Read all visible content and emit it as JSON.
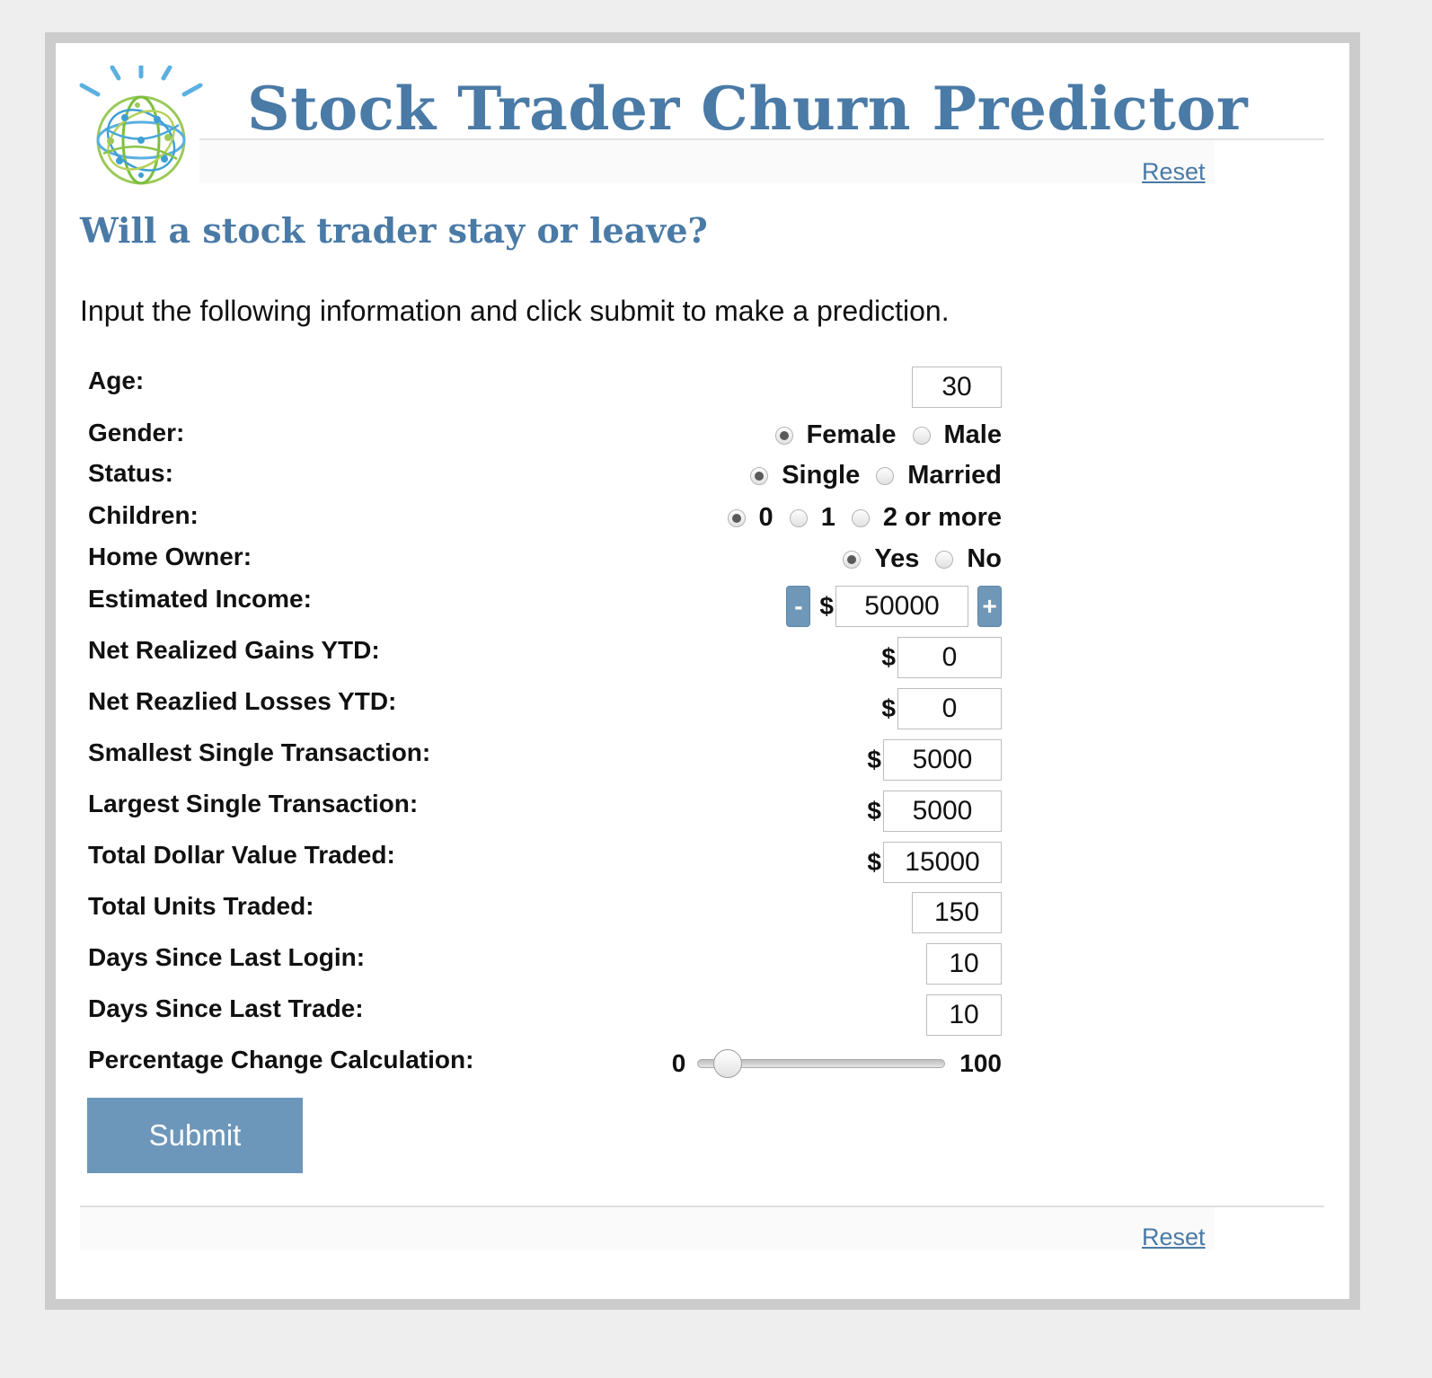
{
  "header": {
    "title": "Stock Trader Churn Predictor",
    "reset_label": "Reset"
  },
  "intro": {
    "heading": "Will a stock trader stay or leave?",
    "text": "Input the following information and click submit to make a prediction."
  },
  "form": {
    "currency_symbol": "$",
    "age": {
      "label": "Age:",
      "value": "30"
    },
    "gender": {
      "label": "Gender:",
      "options": [
        "Female",
        "Male"
      ],
      "selected": "Female"
    },
    "status": {
      "label": "Status:",
      "options": [
        "Single",
        "Married"
      ],
      "selected": "Single"
    },
    "children": {
      "label": "Children:",
      "options": [
        "0",
        "1",
        "2 or more"
      ],
      "selected": "0"
    },
    "home_owner": {
      "label": "Home Owner:",
      "options": [
        "Yes",
        "No"
      ],
      "selected": "Yes"
    },
    "estimated_income": {
      "label": "Estimated Income:",
      "value": "50000",
      "decrement": "-",
      "increment": "+"
    },
    "net_realized_gains": {
      "label": "Net Realized Gains YTD:",
      "value": "0"
    },
    "net_realized_losses": {
      "label": "Net Reazlied Losses YTD:",
      "value": "0"
    },
    "smallest_transaction": {
      "label": "Smallest Single Transaction:",
      "value": "5000"
    },
    "largest_transaction": {
      "label": "Largest Single Transaction:",
      "value": "5000"
    },
    "total_dollar_value": {
      "label": "Total Dollar Value Traded:",
      "value": "15000"
    },
    "total_units": {
      "label": "Total Units Traded:",
      "value": "150"
    },
    "days_since_login": {
      "label": "Days Since Last Login:",
      "value": "10"
    },
    "days_since_trade": {
      "label": "Days Since Last Trade:",
      "value": "10"
    },
    "percentage_change": {
      "label": "Percentage Change Calculation:",
      "min": "0",
      "max": "100",
      "value": 5
    },
    "submit_label": "Submit"
  },
  "footer": {
    "reset_label": "Reset"
  },
  "colors": {
    "accent": "#4a7aa6",
    "button": "#6d97ba",
    "border": "#cccccc"
  },
  "icons": {
    "logo": "watson-globe-icon"
  }
}
